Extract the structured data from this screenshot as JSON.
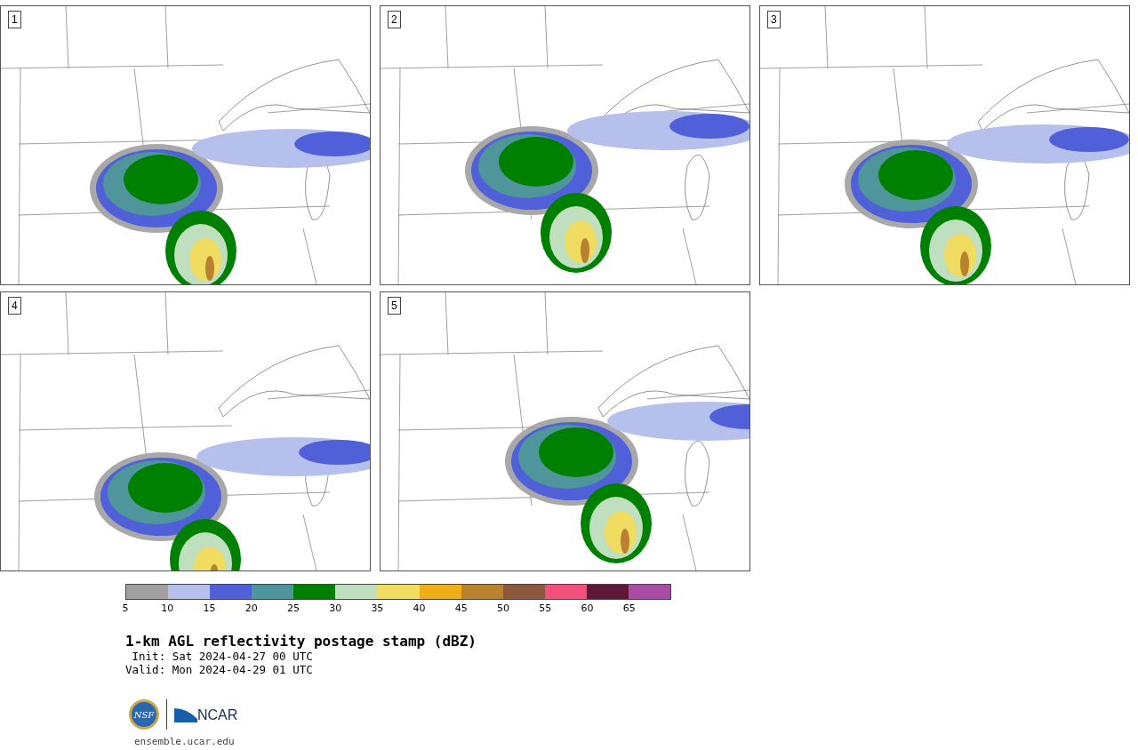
{
  "panels": [
    {
      "number": "1"
    },
    {
      "number": "2"
    },
    {
      "number": "3"
    },
    {
      "number": "4"
    },
    {
      "number": "5"
    }
  ],
  "colorbar": {
    "segments": [
      {
        "color": "#a0a0a0"
      },
      {
        "color": "#b6c0ec"
      },
      {
        "color": "#5060d8"
      },
      {
        "color": "#4f969c"
      },
      {
        "color": "#008000"
      },
      {
        "color": "#bfdfbf"
      },
      {
        "color": "#f0dc60"
      },
      {
        "color": "#eeae18"
      },
      {
        "color": "#b8822e"
      },
      {
        "color": "#8b5a3c"
      },
      {
        "color": "#f4507c"
      },
      {
        "color": "#601838"
      },
      {
        "color": "#a84ca4"
      }
    ],
    "ticks": [
      "5",
      "10",
      "15",
      "20",
      "25",
      "30",
      "35",
      "40",
      "45",
      "50",
      "55",
      "60",
      "65"
    ]
  },
  "title": "1-km AGL reflectivity postage stamp (dBZ)",
  "init": " Init: Sat 2024-04-27 00 UTC",
  "valid": "Valid: Mon 2024-04-29 01 UTC",
  "logos": {
    "seal": "NSF",
    "wordmark": "NCAR"
  },
  "url": "ensemble.ucar.edu"
}
